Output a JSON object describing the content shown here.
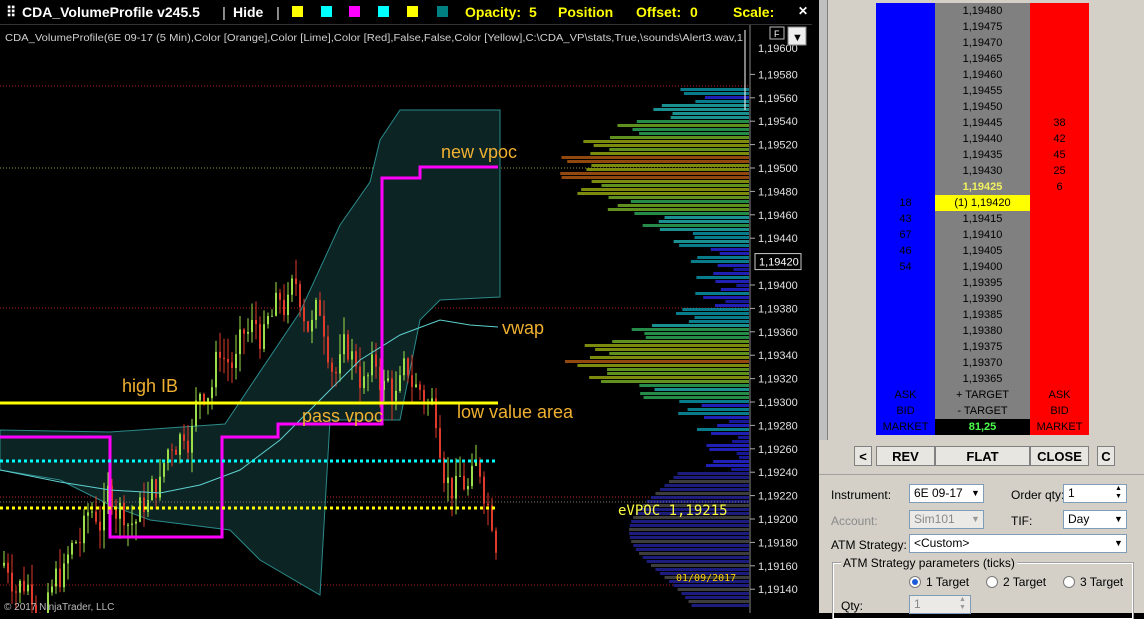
{
  "toolbar": {
    "indicator_name": "CDA_VolumeProfile v245.5",
    "hide_label": "Hide",
    "swatch_colors": [
      "#ffff00",
      "#00ffff",
      "#ff00ff",
      "#00ffff",
      "#ffff00",
      "#008080"
    ],
    "opacity_label": "Opacity:",
    "opacity_value": "5",
    "position_label": "Position",
    "offset_label": "Offset:",
    "offset_value": "0",
    "scale_label": "Scale:"
  },
  "chart": {
    "indicator_params": "CDA_VolumeProfile(6E 09-17 (5 Min),Color [Orange],Color [Lime],Color [Red],False,False,Color [Yellow],C:\\CDA_VP\\stats,True,\\sounds\\Alert3.wav,1",
    "f_button": "F",
    "copyright": "© 2017 NinjaTrader, LLC",
    "date_label": "01/09/2017",
    "evpoc_label": "eVPOC 1,19215",
    "current_price": "1,19420",
    "annotations": {
      "new_vpoc": "new vpoc",
      "vwap": "vwap",
      "high_ib": "high IB",
      "pass_vpoc": "pass vpoc",
      "low_value_area": "low value area"
    },
    "price_axis": [
      "1,19580",
      "1,19560",
      "1,19540",
      "1,19520",
      "1,19500",
      "1,19480",
      "1,19460",
      "1,19440",
      "1,19400",
      "1,19380",
      "1,19360",
      "1,19340",
      "1,19320",
      "1,19300",
      "1,19280",
      "1,19260",
      "1,19240",
      "1,19220",
      "1,19200",
      "1,19180",
      "1,19160",
      "1,19140"
    ],
    "axis_top_partial": "1,19600",
    "colors": {
      "vpoc": "#ff00ff",
      "ib": "#ffff00",
      "value_area": "#00ffff",
      "evpoc": "#ffff00"
    }
  },
  "dom": {
    "rows": [
      {
        "bid": "",
        "price": "1,19480",
        "ask": ""
      },
      {
        "bid": "",
        "price": "1,19475",
        "ask": ""
      },
      {
        "bid": "",
        "price": "1,19470",
        "ask": ""
      },
      {
        "bid": "",
        "price": "1,19465",
        "ask": ""
      },
      {
        "bid": "",
        "price": "1,19460",
        "ask": ""
      },
      {
        "bid": "",
        "price": "1,19455",
        "ask": ""
      },
      {
        "bid": "",
        "price": "1,19450",
        "ask": ""
      },
      {
        "bid": "",
        "price": "1,19445",
        "ask": "38"
      },
      {
        "bid": "",
        "price": "1,19440",
        "ask": "42"
      },
      {
        "bid": "",
        "price": "1,19435",
        "ask": "45"
      },
      {
        "bid": "",
        "price": "1,19430",
        "ask": "25"
      },
      {
        "bid": "",
        "price": "1,19425",
        "ask": "6",
        "style": "last"
      },
      {
        "bid": "18",
        "price": "(1) 1,19420",
        "ask": "",
        "style": "position"
      },
      {
        "bid": "43",
        "price": "1,19415",
        "ask": ""
      },
      {
        "bid": "67",
        "price": "1,19410",
        "ask": ""
      },
      {
        "bid": "46",
        "price": "1,19405",
        "ask": ""
      },
      {
        "bid": "54",
        "price": "1,19400",
        "ask": ""
      },
      {
        "bid": "",
        "price": "1,19395",
        "ask": ""
      },
      {
        "bid": "",
        "price": "1,19390",
        "ask": ""
      },
      {
        "bid": "",
        "price": "1,19385",
        "ask": ""
      },
      {
        "bid": "",
        "price": "1,19380",
        "ask": ""
      },
      {
        "bid": "",
        "price": "1,19375",
        "ask": ""
      },
      {
        "bid": "",
        "price": "1,19370",
        "ask": ""
      },
      {
        "bid": "",
        "price": "1,19365",
        "ask": ""
      }
    ],
    "footer": [
      {
        "left": "ASK",
        "mid": "+ TARGET",
        "right": "ASK"
      },
      {
        "left": "BID",
        "mid": "- TARGET",
        "right": "BID"
      },
      {
        "left": "MARKET",
        "mid": "81,25",
        "right": "MARKET"
      }
    ],
    "buttons": {
      "prev": "<",
      "rev": "REV",
      "flat": "FLAT",
      "close": "CLOSE",
      "c": "C"
    },
    "instrument_label": "Instrument:",
    "instrument_value": "6E 09-17",
    "order_qty_label": "Order qty:",
    "order_qty_value": "1",
    "account_label": "Account:",
    "account_value": "Sim101",
    "tif_label": "TIF:",
    "tif_value": "Day",
    "atm_label": "ATM Strategy:",
    "atm_value": "<Custom>",
    "atm_params_title": "ATM Strategy parameters (ticks)",
    "targets": [
      "1 Target",
      "2 Target",
      "3 Target"
    ],
    "selected_target": "1 Target",
    "qty_label": "Qty:",
    "qty_value": "1"
  }
}
